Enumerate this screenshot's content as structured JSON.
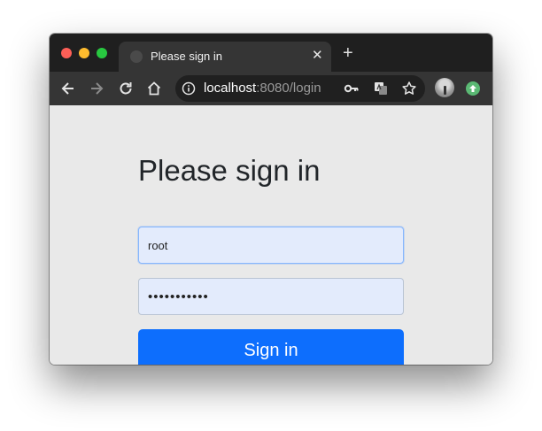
{
  "browser": {
    "tab": {
      "title": "Please sign in"
    },
    "address": {
      "host": "localhost",
      "rest": ":8080/login"
    }
  },
  "form": {
    "heading": "Please sign in",
    "username_value": "root",
    "password_value": "•••••••••••",
    "submit_label": "Sign in"
  },
  "colors": {
    "accent": "#0d6efd",
    "field_background": "#e3ebfc",
    "page_background": "#e9e9e9",
    "chrome_dark": "#353535"
  },
  "icons": [
    "back-icon",
    "forward-icon",
    "reload-icon",
    "home-icon",
    "info-icon",
    "key-icon",
    "translate-icon",
    "star-icon",
    "avatar",
    "update-icon",
    "close-icon",
    "plus-icon"
  ]
}
